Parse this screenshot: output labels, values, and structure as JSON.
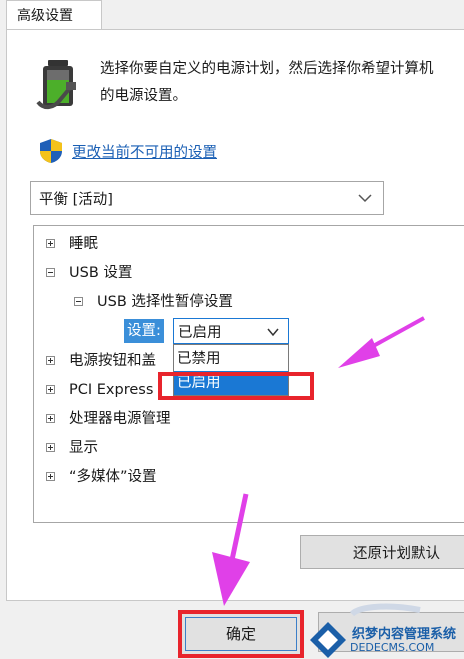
{
  "tab": {
    "label": "高级设置"
  },
  "header": {
    "description": "选择你要自定义的电源计划，然后选择你希望计算机\n的电源设置。",
    "change_link": "更改当前不可用的设置"
  },
  "plan_dropdown": {
    "value": "平衡 [活动]"
  },
  "tree": {
    "items": [
      {
        "label": "睡眠",
        "state": "plus"
      },
      {
        "label": "USB 设置",
        "state": "minus"
      },
      {
        "label": "USB 选择性暂停设置",
        "state": "minus"
      },
      {
        "label": "电源按钮和盖",
        "state": "plus"
      },
      {
        "label": "PCI Express",
        "state": "plus"
      },
      {
        "label": "处理器电源管理",
        "state": "plus"
      },
      {
        "label": "显示",
        "state": "plus"
      },
      {
        "label": "“多媒体”设置",
        "state": "plus"
      }
    ],
    "setting_label": "设置:",
    "setting_value": "已启用",
    "options": [
      "已禁用",
      "已启用"
    ]
  },
  "buttons": {
    "restore": "还原计划默认",
    "ok": "确定"
  },
  "watermark": {
    "line1": "织梦内容管理系统",
    "line2": "DEDECMS.COM"
  },
  "colors": {
    "highlight": "#1a78d4",
    "annotation_red": "#e8242c",
    "arrow_magenta": "#e040e8",
    "link": "#1a5fb4"
  }
}
